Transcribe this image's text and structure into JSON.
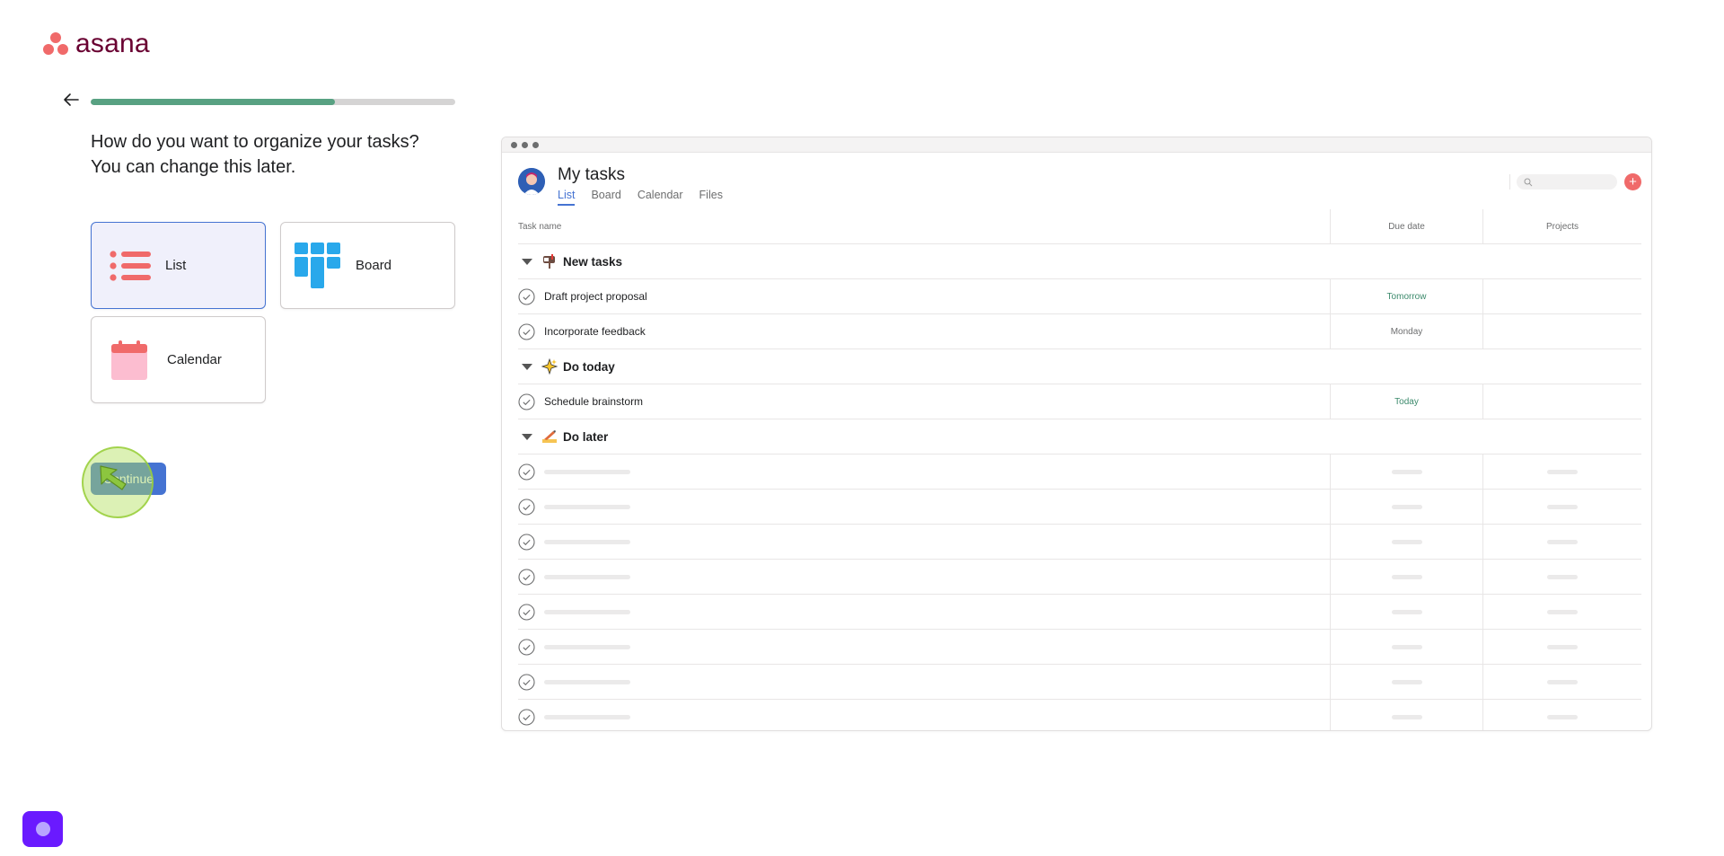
{
  "brand": {
    "name": "asana"
  },
  "onboarding": {
    "progress_fraction": 0.67,
    "question_line1": "How do you want to organize your tasks?",
    "question_line2": "You can change this later.",
    "options": [
      {
        "label": "List",
        "selected": true
      },
      {
        "label": "Board",
        "selected": false
      },
      {
        "label": "Calendar",
        "selected": false
      }
    ],
    "continue_label": "Continue"
  },
  "preview": {
    "title": "My tasks",
    "tabs": [
      "List",
      "Board",
      "Calendar",
      "Files"
    ],
    "columns": [
      "Task name",
      "Due date",
      "Projects"
    ],
    "sections": [
      {
        "name": "New tasks",
        "emoji": "mailbox-icon",
        "tasks": [
          {
            "name": "Draft project proposal",
            "due": "Tomorrow"
          },
          {
            "name": "Incorporate feedback",
            "due": "Monday"
          }
        ]
      },
      {
        "name": "Do today",
        "emoji": "sparkles-icon",
        "tasks": [
          {
            "name": "Schedule brainstorm",
            "due": "Today"
          }
        ]
      },
      {
        "name": "Do later",
        "emoji": "writing-hand-icon",
        "tasks": []
      }
    ],
    "placeholder_rows": 8
  },
  "colors": {
    "brand": "#f06a6a",
    "logo_text": "#690031",
    "progress": "#58a182",
    "primary_button": "#4573d2",
    "help_button": "#6a1aff"
  }
}
